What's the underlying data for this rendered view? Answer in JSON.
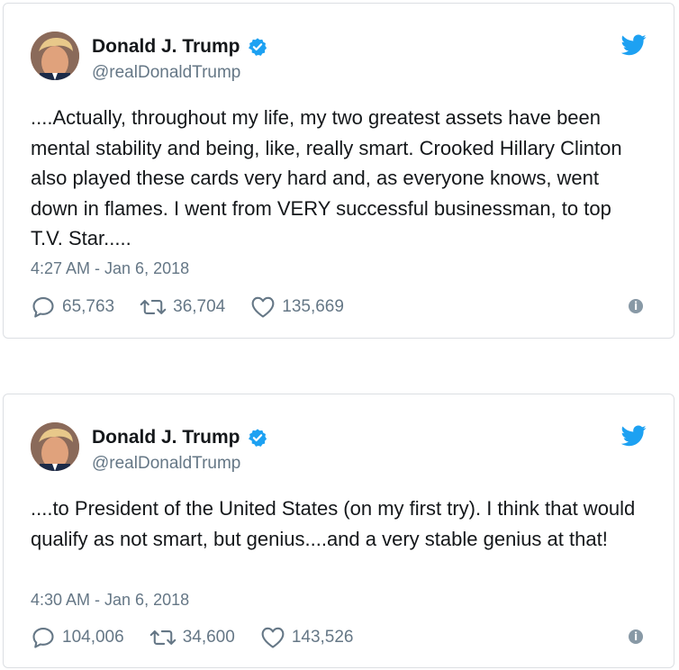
{
  "colors": {
    "brand_blue": "#1da1f2",
    "text_primary": "#14171a",
    "text_secondary": "#657786",
    "border": "#dcdfe3"
  },
  "icons": {
    "verified": "verified-badge-icon",
    "brand": "twitter-bird-icon",
    "reply": "reply-icon",
    "retweet": "retweet-icon",
    "like": "heart-icon",
    "info": "info-icon"
  },
  "tweets": [
    {
      "author_name": "Donald J. Trump",
      "handle": "@realDonaldTrump",
      "text": "....Actually, throughout my life, my two greatest assets have been mental stability and being, like, really smart. Crooked Hillary Clinton also played these cards very hard and, as everyone knows, went down in flames. I went from VERY successful businessman, to top T.V. Star.....",
      "timestamp": "4:27 AM - Jan 6, 2018",
      "replies": "65,763",
      "retweets": "36,704",
      "likes": "135,669"
    },
    {
      "author_name": "Donald J. Trump",
      "handle": "@realDonaldTrump",
      "text": "....to President of the United States (on my first try). I think that would qualify as not smart, but genius....and a very stable genius at that!",
      "timestamp": "4:30 AM - Jan 6, 2018",
      "replies": "104,006",
      "retweets": "34,600",
      "likes": "143,526"
    }
  ]
}
